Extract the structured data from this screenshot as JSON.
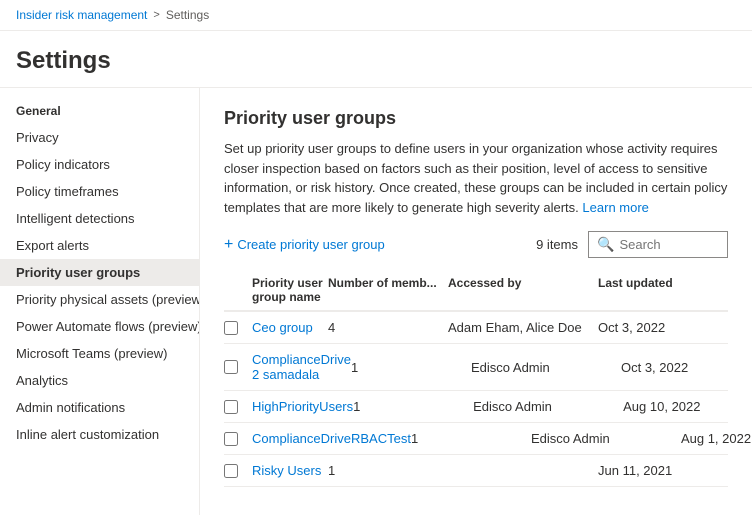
{
  "breadcrumb": {
    "parent": "Insider risk management",
    "separator": ">",
    "current": "Settings"
  },
  "page": {
    "title": "Settings"
  },
  "sidebar": {
    "section_label": "General",
    "items": [
      {
        "id": "privacy",
        "label": "Privacy",
        "active": false
      },
      {
        "id": "policy-indicators",
        "label": "Policy indicators",
        "active": false
      },
      {
        "id": "policy-timeframes",
        "label": "Policy timeframes",
        "active": false
      },
      {
        "id": "intelligent-detections",
        "label": "Intelligent detections",
        "active": false
      },
      {
        "id": "export-alerts",
        "label": "Export alerts",
        "active": false
      },
      {
        "id": "priority-user-groups",
        "label": "Priority user groups",
        "active": true
      },
      {
        "id": "priority-physical-assets",
        "label": "Priority physical assets (preview)",
        "active": false
      },
      {
        "id": "power-automate-flows",
        "label": "Power Automate flows (preview)",
        "active": false
      },
      {
        "id": "microsoft-teams",
        "label": "Microsoft Teams (preview)",
        "active": false
      },
      {
        "id": "analytics",
        "label": "Analytics",
        "active": false
      },
      {
        "id": "admin-notifications",
        "label": "Admin notifications",
        "active": false
      },
      {
        "id": "inline-alert-customization",
        "label": "Inline alert customization",
        "active": false
      }
    ]
  },
  "content": {
    "title": "Priority user groups",
    "description": "Set up priority user groups to define users in your organization whose activity requires closer inspection based on factors such as their position, level of access to sensitive information, or risk history. Once created, these groups can be included in certain policy templates that are more likely to generate high severity alerts.",
    "learn_more_label": "Learn more",
    "create_btn_label": "Create priority user group",
    "item_count": "9 items",
    "search_placeholder": "Search",
    "table": {
      "headers": [
        {
          "id": "checkbox",
          "label": ""
        },
        {
          "id": "name",
          "label": "Priority user group name"
        },
        {
          "id": "members",
          "label": "Number of memb..."
        },
        {
          "id": "accessed-by",
          "label": "Accessed by"
        },
        {
          "id": "last-updated",
          "label": "Last updated"
        }
      ],
      "rows": [
        {
          "name": "Ceo group",
          "members": "4",
          "accessed_by": "Adam Eham, Alice Doe",
          "last_updated": "Oct 3, 2022"
        },
        {
          "name": "ComplianceDrive 2 samadala",
          "members": "1",
          "accessed_by": "Edisco Admin",
          "last_updated": "Oct 3, 2022"
        },
        {
          "name": "HighPriorityUsers",
          "members": "1",
          "accessed_by": "Edisco Admin",
          "last_updated": "Aug 10, 2022"
        },
        {
          "name": "ComplianceDriveRBACTest",
          "members": "1",
          "accessed_by": "Edisco Admin",
          "last_updated": "Aug 1, 2022"
        },
        {
          "name": "Risky Users",
          "members": "1",
          "accessed_by": "",
          "last_updated": "Jun 11, 2021"
        }
      ]
    }
  },
  "icons": {
    "plus": "+",
    "search": "🔍",
    "chevron": "›"
  }
}
